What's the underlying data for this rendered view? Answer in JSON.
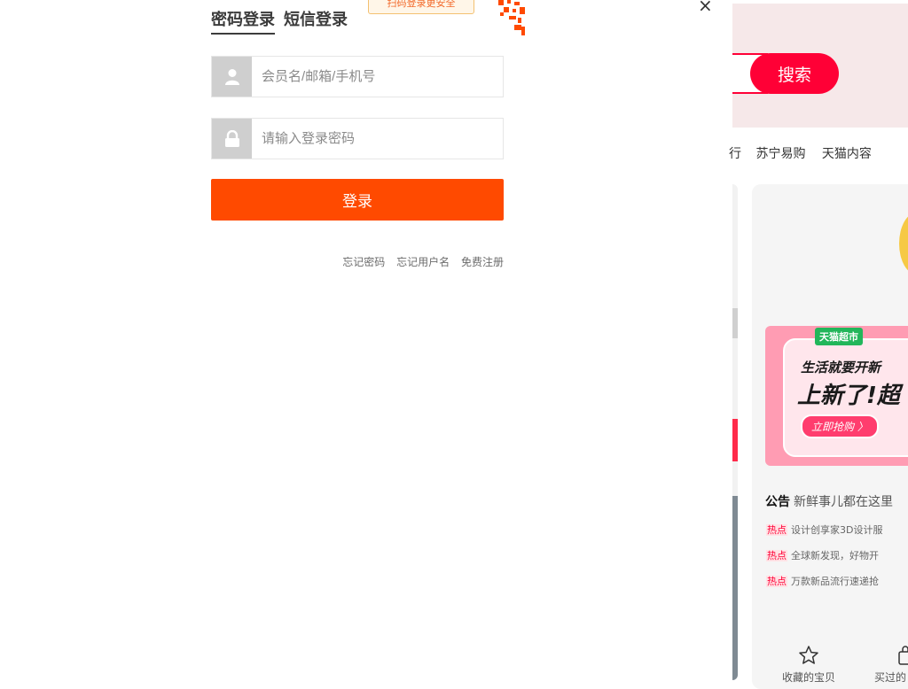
{
  "login": {
    "tabs": [
      "密码登录",
      "短信登录"
    ],
    "qr_tip": "扫码登录更安全",
    "username_placeholder": "会员名/邮箱/手机号",
    "password_placeholder": "请输入登录密码",
    "login_label": "登录",
    "links": [
      "忘记密码",
      "忘记用户名",
      "免费注册"
    ],
    "close": "×"
  },
  "background": {
    "search_label": "搜索",
    "nav_links": [
      "行",
      "苏宁易购",
      "天猫内容"
    ],
    "banner": {
      "tag": "天猫超市",
      "line1": "生活就要开新",
      "line2": "上新了!超",
      "cta": "立即抢购 〉"
    },
    "notice": {
      "label": "公告",
      "text": "新鲜事儿都在这里"
    },
    "hot_items": [
      {
        "tag": "热点",
        "text": "设计创享家3D设计服"
      },
      {
        "tag": "热点",
        "text": "全球新发现，好物开"
      },
      {
        "tag": "热点",
        "text": "万款新品流行速递抢"
      }
    ],
    "quick_links": [
      {
        "icon": "star-icon",
        "label": "收藏的宝贝"
      },
      {
        "icon": "bag-icon",
        "label": "买过的"
      }
    ]
  },
  "colors": {
    "login_button": "#ff4a00",
    "search_button": "#ff0036",
    "hot_tag": "#ff0036"
  }
}
